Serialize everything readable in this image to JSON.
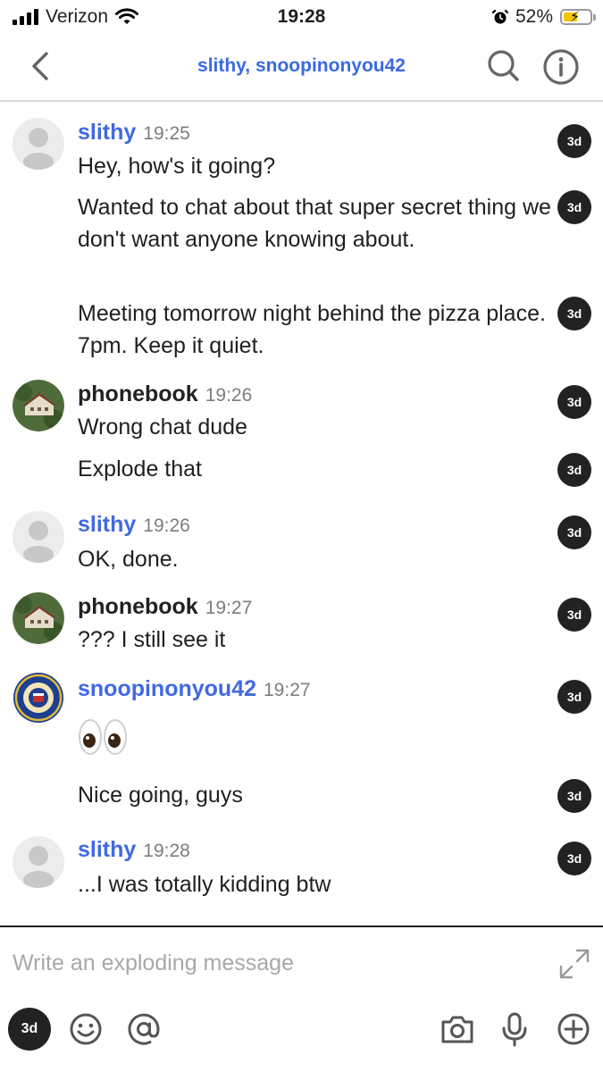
{
  "status_bar": {
    "carrier": "Verizon",
    "time": "19:28",
    "battery_percent": "52%",
    "battery_level": 0.52,
    "icons": [
      "signal-icon",
      "wifi-icon",
      "alarm-icon",
      "battery-icon"
    ]
  },
  "header": {
    "title": "slithy, snoopinonyou42",
    "icons": [
      "back-chevron-icon",
      "search-icon",
      "info-icon"
    ]
  },
  "timer_badge": "3d",
  "messages": [
    {
      "author": "slithy",
      "time": "19:25",
      "lines": [
        "Hey, how's it going?",
        "Wanted to chat about that super secret thing we don't want anyone knowing about.",
        "Meeting tomorrow night behind the pizza place. 7pm. Keep it quiet."
      ]
    },
    {
      "author": "phonebook",
      "time": "19:26",
      "lines": [
        "Wrong chat dude",
        "Explode that"
      ]
    },
    {
      "author": "slithy",
      "time": "19:26",
      "lines": [
        "OK, done."
      ]
    },
    {
      "author": "phonebook",
      "time": "19:27",
      "lines": [
        "??? I still see it"
      ]
    },
    {
      "author": "snoopinonyou42",
      "time": "19:27",
      "lines": [
        "eyes-emoji",
        "Nice going, guys"
      ]
    },
    {
      "author": "slithy",
      "time": "19:28",
      "lines": [
        "...I was totally kidding btw"
      ]
    }
  ],
  "composer": {
    "placeholder": "Write an exploding message",
    "timer_label": "3d",
    "icons": [
      "expand-icon",
      "emoji-icon",
      "mention-icon",
      "camera-icon",
      "microphone-icon",
      "add-icon"
    ]
  },
  "colors": {
    "link_blue": "#4169e1",
    "title_blue": "#3b6ae0",
    "timer_bg": "#222222",
    "battery_yellow": "#f5c400"
  }
}
